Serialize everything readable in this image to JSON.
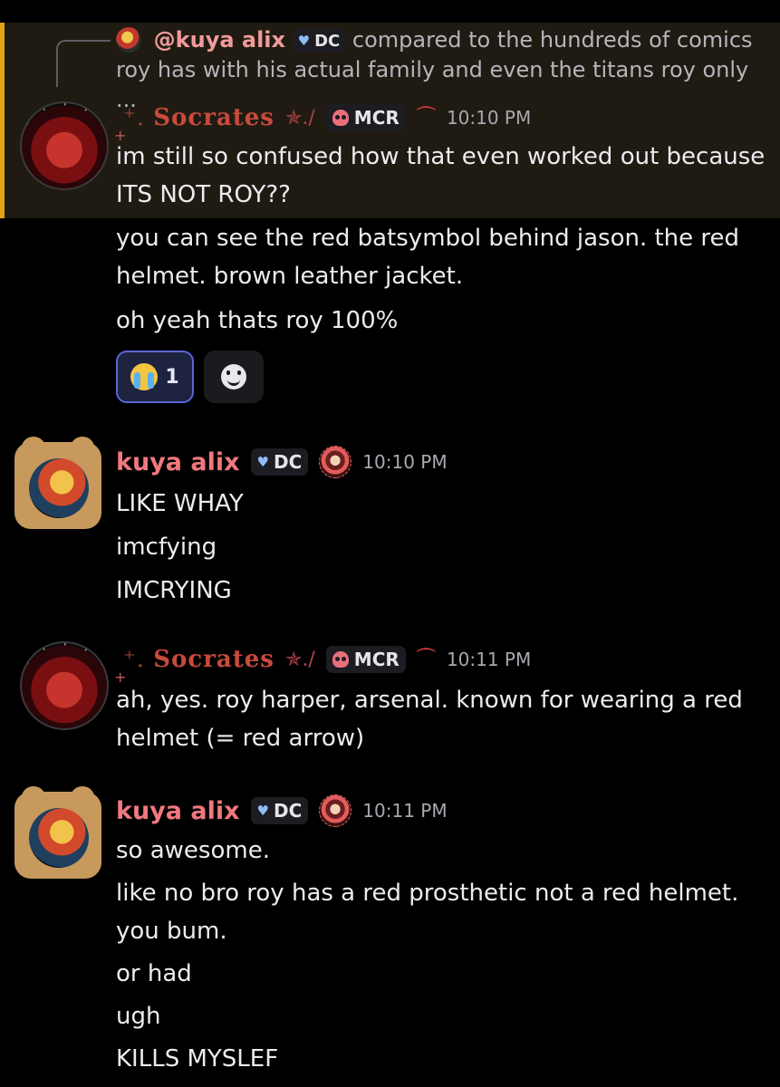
{
  "reply": {
    "author": "@kuya alix",
    "tag": "DC",
    "text": "compared to the hundreds of comics roy has with his actual family and even the titans roy only ..."
  },
  "messages": [
    {
      "author": "Socrates",
      "author_prefix": "⁺. ",
      "role_tag": "MCR",
      "time": "10:10 PM",
      "lines": [
        "im still so confused how that even worked out because ITS NOT ROY??",
        "you can see the red batsymbol behind jason. the red helmet. brown leather jacket.",
        "oh yeah thats roy 100%"
      ],
      "reactions": [
        {
          "emoji": "loudly-crying-face",
          "count": "1",
          "active": true
        }
      ]
    },
    {
      "author": "kuya alix",
      "role_tag": "DC",
      "time": "10:10 PM",
      "lines": [
        "LIKE WHAY",
        "imcfying",
        "IMCRYING"
      ]
    },
    {
      "author": "Socrates",
      "author_prefix": "⁺. ",
      "role_tag": "MCR",
      "time": "10:11 PM",
      "lines": [
        "ah, yes. roy harper, arsenal. known for wearing a red helmet (= red arrow)"
      ]
    },
    {
      "author": "kuya alix",
      "role_tag": "DC",
      "time": "10:11 PM",
      "lines": [
        "so awesome.",
        "like no bro roy has a red prosthetic not a red helmet. you bum.",
        "or had",
        "ugh",
        "KILLS MYSLEF"
      ]
    }
  ],
  "colors": {
    "background": "#000000",
    "mention_highlight": "#1f1b12",
    "mention_bar": "#e3a21a",
    "socrates_name": "#c84a3b",
    "alix_name": "#f0787f",
    "reaction_active_border": "#5b66d6"
  }
}
